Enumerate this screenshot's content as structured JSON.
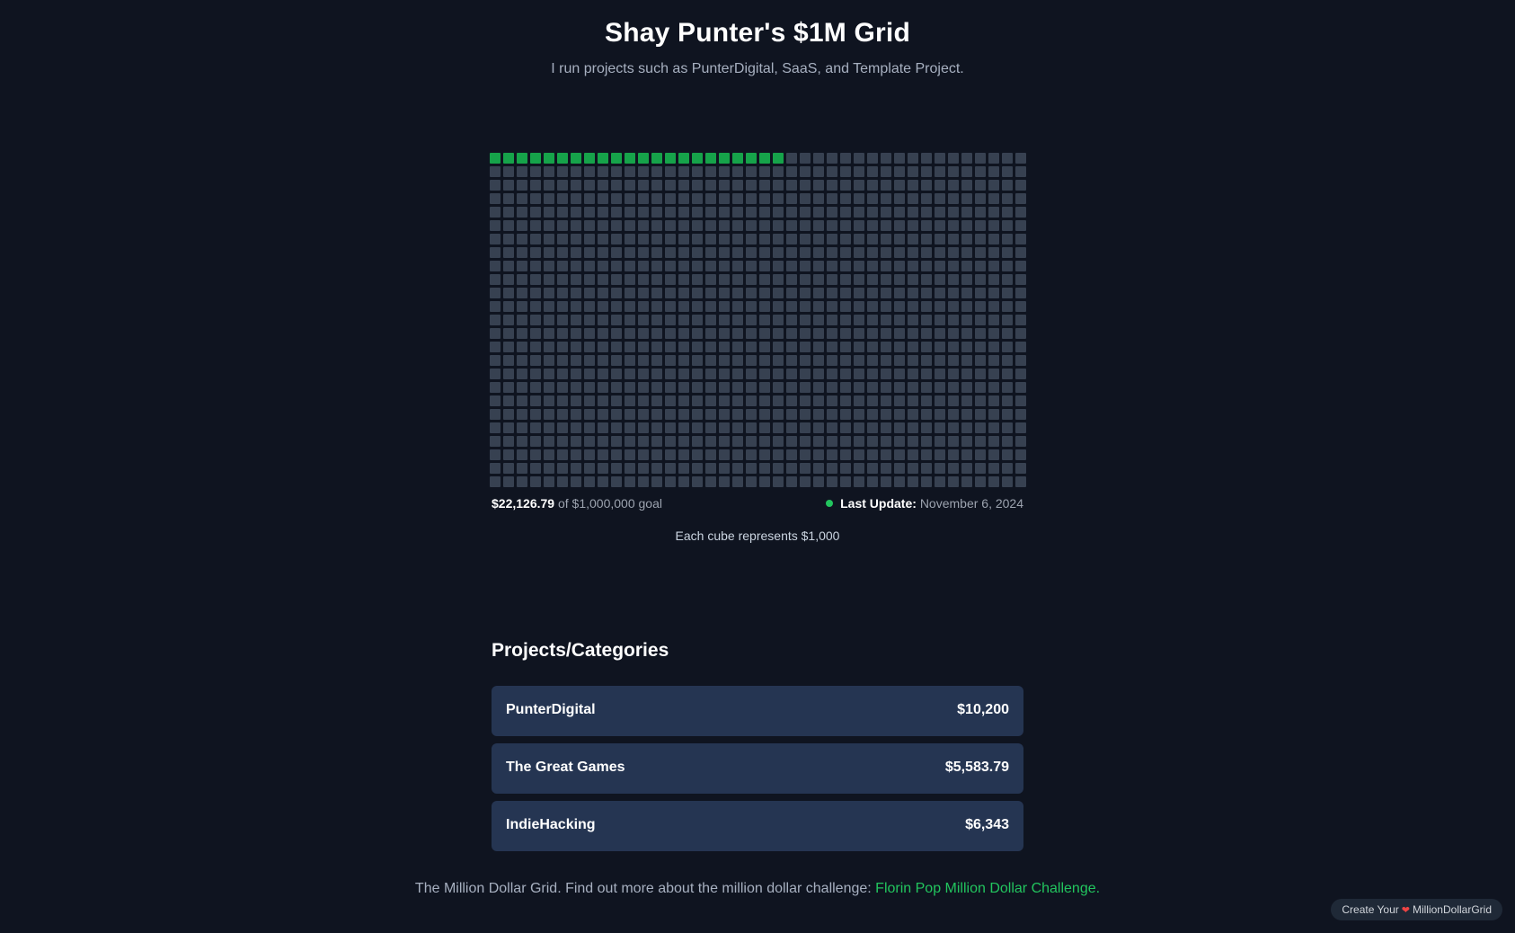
{
  "header": {
    "title": "Shay Punter's $1M Grid",
    "subtitle": "I run projects such as PunterDigital, SaaS, and Template Project."
  },
  "grid": {
    "total_cubes": 1000,
    "filled_cubes": 22,
    "filled_color": "#16a34a",
    "empty_color": "#374151"
  },
  "progress": {
    "amount": "$22,126.79",
    "goal_text": "of $1,000,000 goal",
    "last_update_label": "Last Update:",
    "last_update_date": "November 6, 2024",
    "status_color": "#22c55e"
  },
  "cube_note": "Each cube represents $1,000",
  "projects": {
    "title": "Projects/Categories",
    "items": [
      {
        "name": "PunterDigital",
        "amount": "$10,200"
      },
      {
        "name": "The Great Games",
        "amount": "$5,583.79"
      },
      {
        "name": "IndieHacking",
        "amount": "$6,343"
      }
    ]
  },
  "footer": {
    "text": "The Million Dollar Grid. Find out more about the million dollar challenge: ",
    "link_text": "Florin Pop Million Dollar Challenge."
  },
  "badge": {
    "prefix": "Create Your",
    "heart_icon": "heart-icon",
    "suffix": "MillionDollarGrid"
  },
  "colors": {
    "background": "#0f1420",
    "accent": "#22c55e",
    "card": "#253552"
  }
}
